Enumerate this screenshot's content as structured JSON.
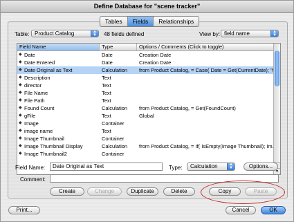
{
  "window": {
    "title": "Define Database for \"scene tracker\""
  },
  "tabs": [
    {
      "label": "Tables",
      "active": false
    },
    {
      "label": "Fields",
      "active": true
    },
    {
      "label": "Relationships",
      "active": false
    }
  ],
  "table_selector": {
    "label": "Table:",
    "value": "Product Catalog"
  },
  "field_count": "48 fields defined",
  "view_by": {
    "label": "View by:",
    "value": "field name"
  },
  "list": {
    "columns": [
      "Field Name",
      "Type",
      "Options / Comments   (Click to toggle)"
    ],
    "rows": [
      {
        "name": "Date",
        "type": "Date",
        "options": "Creation Date",
        "selected": false
      },
      {
        "name": "Date Entered",
        "type": "Date",
        "options": "Creation Date",
        "selected": false
      },
      {
        "name": "Date Original as Text",
        "type": "Calculation",
        "options": "from Product Catalog, = Case( Date = Get(CurrentDate); \"t...",
        "selected": true
      },
      {
        "name": "Description",
        "type": "Text",
        "options": "",
        "selected": false
      },
      {
        "name": "director",
        "type": "Text",
        "options": "",
        "selected": false
      },
      {
        "name": "File Name",
        "type": "Text",
        "options": "",
        "selected": false
      },
      {
        "name": "File Path",
        "type": "Text",
        "options": "",
        "selected": false
      },
      {
        "name": "Found Count",
        "type": "Calculation",
        "options": "from Product Catalog, = Get(FoundCount)",
        "selected": false
      },
      {
        "name": "gFile",
        "type": "Text",
        "options": "Global",
        "selected": false
      },
      {
        "name": "Image",
        "type": "Container",
        "options": "",
        "selected": false
      },
      {
        "name": "image name",
        "type": "Text",
        "options": "",
        "selected": false
      },
      {
        "name": "Image Thumbnail",
        "type": "Container",
        "options": "",
        "selected": false
      },
      {
        "name": "Image Thumbnail Display",
        "type": "Calculation",
        "options": "from Product Catalog, = If( IsEmpty(Image Thumbnail); Im...",
        "selected": false
      },
      {
        "name": "Image Thumbnail2",
        "type": "Container",
        "options": "",
        "selected": false
      }
    ]
  },
  "field_name": {
    "label": "Field Name:",
    "value": "Date Original as Text"
  },
  "type": {
    "label": "Type:",
    "value": "Calculation"
  },
  "options_button": "Options...",
  "comment": {
    "label": "Comment:",
    "value": ""
  },
  "buttons": {
    "create": "Create",
    "change": "Change",
    "duplicate": "Duplicate",
    "delete": "Delete",
    "copy": "Copy",
    "paste": "Paste",
    "print": "Print...",
    "cancel": "Cancel",
    "ok": "OK"
  }
}
